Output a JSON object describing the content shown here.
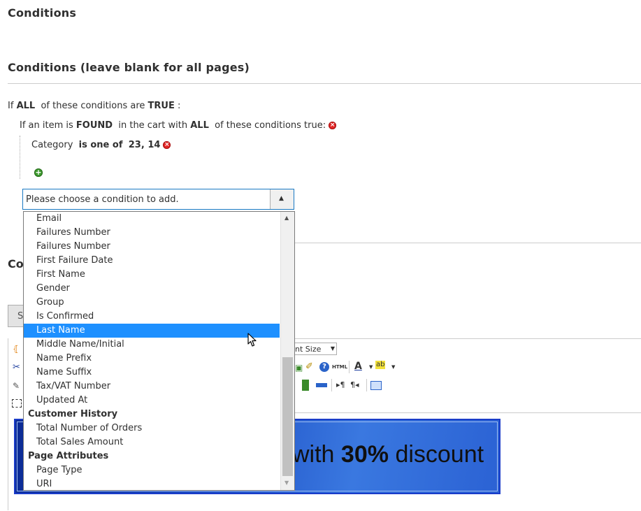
{
  "section_title": "Conditions",
  "subsection_title": "Conditions (leave blank for all pages)",
  "rule": {
    "prefix": "If",
    "aggregator": "ALL",
    "middle": "of these conditions are",
    "value": "TRUE",
    "suffix": ":"
  },
  "product_rule": {
    "prefix": "If an item is",
    "found": "FOUND",
    "middle": "in the cart with",
    "aggregator": "ALL",
    "suffix": "of these conditions true:"
  },
  "category_condition": {
    "attribute": "Category",
    "operator": "is one of",
    "value": "23, 14"
  },
  "select": {
    "placeholder": "Please choose a condition to add.",
    "options": [
      {
        "label": "Email",
        "type": "option"
      },
      {
        "label": "Failures Number",
        "type": "option"
      },
      {
        "label": "Failures Number",
        "type": "option"
      },
      {
        "label": "First Failure Date",
        "type": "option"
      },
      {
        "label": "First Name",
        "type": "option"
      },
      {
        "label": "Gender",
        "type": "option"
      },
      {
        "label": "Group",
        "type": "option"
      },
      {
        "label": "Is Confirmed",
        "type": "option"
      },
      {
        "label": "Last Name",
        "type": "option",
        "selected": true
      },
      {
        "label": "Middle Name/Initial",
        "type": "option"
      },
      {
        "label": "Name Prefix",
        "type": "option"
      },
      {
        "label": "Name Suffix",
        "type": "option"
      },
      {
        "label": "Tax/VAT Number",
        "type": "option"
      },
      {
        "label": "Updated At",
        "type": "option"
      },
      {
        "label": "Customer History",
        "type": "group"
      },
      {
        "label": "Total Number of Orders",
        "type": "option"
      },
      {
        "label": "Total Sales Amount",
        "type": "option"
      },
      {
        "label": "Page Attributes",
        "type": "group"
      },
      {
        "label": "Page Type",
        "type": "option"
      },
      {
        "label": "URI",
        "type": "option"
      }
    ]
  },
  "partial": {
    "content_heading": "Co",
    "show_button": "S",
    "font_size": "nt Size",
    "html_label": "HTML"
  },
  "banner": {
    "text_prefix": "with",
    "text_bold": "30%",
    "text_suffix": "discount"
  },
  "colors": {
    "accent": "#1979c3",
    "highlight": "#1e90ff",
    "delete": "#e22626",
    "add": "#3f9b2f",
    "banner": "#1d4fc4"
  }
}
